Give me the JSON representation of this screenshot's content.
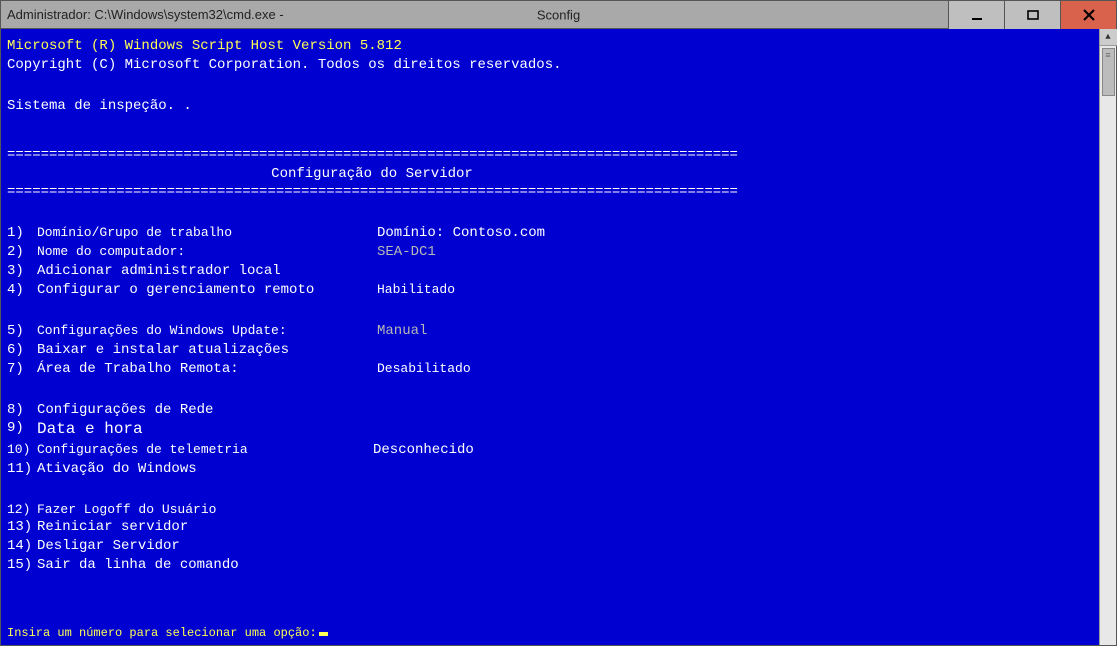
{
  "titlebar": {
    "left": "Administrador: C:\\Windows\\system32\\cmd.exe -",
    "center": "Sconfig"
  },
  "header": {
    "line1": "Microsoft (R) Windows Script Host Version 5.812",
    "line2": "Copyright (C) Microsoft Corporation. Todos os direitos reservados.",
    "line3": "Sistema de inspeção.   ."
  },
  "rule": "=======================================================================================",
  "section_title": "Configuração do Servidor",
  "menu": {
    "r1": {
      "n": "1)",
      "label": "Domínio/Grupo de trabalho",
      "value": "Domínio: Contoso.com"
    },
    "r2": {
      "n": "2)",
      "label": "Nome do computador:",
      "value": "SEA-DC1"
    },
    "r3": {
      "n": "3)",
      "label": "Adicionar administrador local",
      "value": ""
    },
    "r4": {
      "n": "4)",
      "label": "Configurar o gerenciamento remoto",
      "value": "Habilitado"
    },
    "r5": {
      "n": "5)",
      "label": "Configurações do Windows Update:",
      "value": "Manual"
    },
    "r6": {
      "n": "6)",
      "label": "Baixar e instalar atualizações",
      "value": ""
    },
    "r7": {
      "n": "7)",
      "label": "Área de Trabalho Remota:",
      "value": "Desabilitado"
    },
    "r8": {
      "n": "8)",
      "label": "Configurações de Rede",
      "value": ""
    },
    "r9": {
      "n": "9)",
      "label": "Data e hora",
      "value": ""
    },
    "r10": {
      "n": "10)",
      "label": "Configurações de telemetria",
      "value": "Desconhecido"
    },
    "r11": {
      "n": "11)",
      "label": "Ativação do Windows",
      "value": ""
    },
    "r12": {
      "n": "12)",
      "label": "Fazer Logoff do Usuário",
      "value": ""
    },
    "r13": {
      "n": "13)",
      "label": "Reiniciar servidor",
      "value": ""
    },
    "r14": {
      "n": "14)",
      "label": "Desligar Servidor",
      "value": ""
    },
    "r15": {
      "n": "15)",
      "label": "Sair da linha de comando",
      "value": ""
    }
  },
  "prompt": "Insira um número para selecionar uma opção:",
  "scroll": {
    "up": "▲"
  }
}
